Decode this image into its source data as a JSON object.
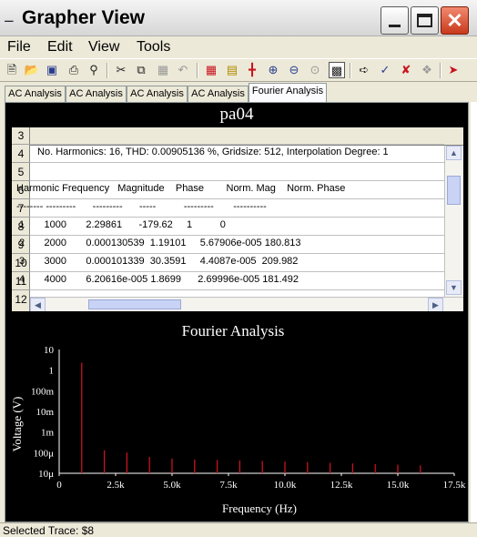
{
  "window": {
    "title": "Grapher View",
    "app_icon": "grapher-icon"
  },
  "menu": [
    "File",
    "Edit",
    "View",
    "Tools"
  ],
  "toolbar": [
    "new-icon",
    "open-icon",
    "save-icon",
    "print-icon",
    "print-preview-icon",
    "cut-icon",
    "copy-icon",
    "paste-icon",
    "undo-icon",
    "grid-icon",
    "legend-icon",
    "cursor-icon",
    "zoom-in-icon",
    "zoom-out-icon",
    "zoom-fit-icon",
    "black-background-icon",
    "select-trace-icon",
    "properties-icon",
    "delete-trace-icon",
    "trace-options-icon",
    "export-icon"
  ],
  "tabs": [
    "AC Analysis",
    "AC Analysis",
    "AC Analysis",
    "AC Analysis",
    "Fourier Analysis"
  ],
  "active_tab": 4,
  "analysis_title": "pa04",
  "table": {
    "row_numbers": [
      "3",
      "4",
      "5",
      "6",
      "7",
      "8",
      "9",
      "10",
      "11",
      "12"
    ],
    "rows": [
      "",
      " No. Harmonics: 16, THD: 0.00905136 %, Gridsize: 512, Interpolation Degree: 1",
      "",
      "Harmonic Frequency   Magnitude    Phase        Norm. Mag    Norm. Phase",
      "-------- ---------      ---------      -----          ---------       ----------",
      "1       1000       2.29861      -179.62     1          0",
      "2       2000       0.000130539  1.19101     5.67906e-005 180.813",
      "3       3000       0.000101339  30.3591     4.4087e-005  209.982",
      "4       4000       6.20616e-005 1.8699      2.69996e-005 181.492",
      ""
    ]
  },
  "chart_data": {
    "type": "bar",
    "title": "Fourier Analysis",
    "xlabel": "Frequency (Hz)",
    "ylabel": "Voltage (V)",
    "y_scale": "log",
    "x_ticks": [
      "0",
      "2.5k",
      "5.0k",
      "7.5k",
      "10.0k",
      "12.5k",
      "15.0k",
      "17.5k"
    ],
    "y_ticks": [
      "10",
      "1",
      "100m",
      "10m",
      "1m",
      "100μ",
      "10μ"
    ],
    "xlim": [
      0,
      17500
    ],
    "ylim": [
      1e-05,
      10
    ],
    "x": [
      1000,
      2000,
      3000,
      4000,
      5000,
      6000,
      7000,
      8000,
      9000,
      10000,
      11000,
      12000,
      13000,
      14000,
      15000,
      16000
    ],
    "values": [
      2.29861,
      0.000130539,
      0.000101339,
      6.20616e-05,
      5.2e-05,
      4.6e-05,
      4.4e-05,
      4.2e-05,
      4e-05,
      3.7e-05,
      3.5e-05,
      3.2e-05,
      3e-05,
      2.8e-05,
      2.6e-05,
      2.4e-05
    ],
    "color": "#c8141e",
    "grid": false
  },
  "status": "Selected Trace:  $8"
}
